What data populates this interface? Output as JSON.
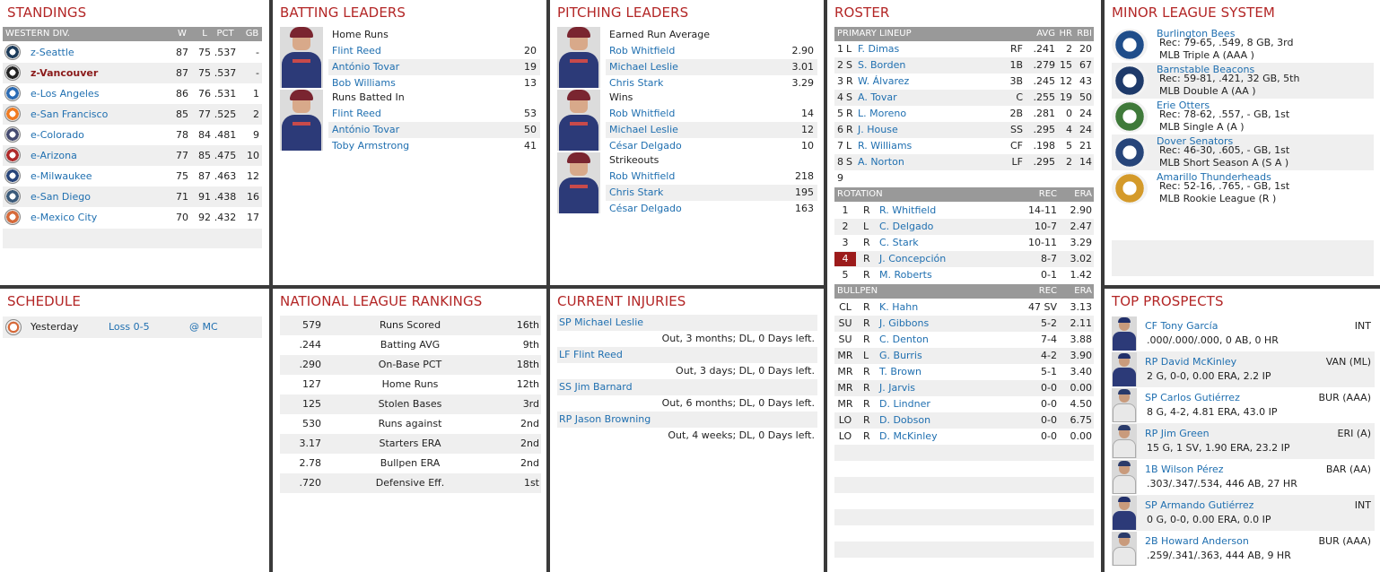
{
  "standings": {
    "title": "STANDINGS",
    "division": "WESTERN DIV.",
    "cols": [
      "W",
      "L",
      "PCT",
      "GB"
    ],
    "teams": [
      {
        "name": "z-Seattle",
        "w": "87",
        "l": "75",
        "pct": ".537",
        "gb": "-",
        "bold": false,
        "logo": "seattle-logo",
        "color": "#1c3b5a"
      },
      {
        "name": "z-Vancouver",
        "w": "87",
        "l": "75",
        "pct": ".537",
        "gb": "-",
        "bold": true,
        "logo": "vancouver-logo",
        "color": "#222"
      },
      {
        "name": "e-Los Angeles",
        "w": "86",
        "l": "76",
        "pct": ".531",
        "gb": "1",
        "bold": false,
        "logo": "los-angeles-logo",
        "color": "#2a6bb4"
      },
      {
        "name": "e-San Francisco",
        "w": "85",
        "l": "77",
        "pct": ".525",
        "gb": "2",
        "bold": false,
        "logo": "san-francisco-logo",
        "color": "#f07a20"
      },
      {
        "name": "e-Colorado",
        "w": "78",
        "l": "84",
        "pct": ".481",
        "gb": "9",
        "bold": false,
        "logo": "colorado-logo",
        "color": "#444a70"
      },
      {
        "name": "e-Arizona",
        "w": "77",
        "l": "85",
        "pct": ".475",
        "gb": "10",
        "bold": false,
        "logo": "arizona-logo",
        "color": "#b02a2a"
      },
      {
        "name": "e-Milwaukee",
        "w": "75",
        "l": "87",
        "pct": ".463",
        "gb": "12",
        "bold": false,
        "logo": "milwaukee-logo",
        "color": "#27457a"
      },
      {
        "name": "e-San Diego",
        "w": "71",
        "l": "91",
        "pct": ".438",
        "gb": "16",
        "bold": false,
        "logo": "san-diego-logo",
        "color": "#3a5a7a"
      },
      {
        "name": "e-Mexico City",
        "w": "70",
        "l": "92",
        "pct": ".432",
        "gb": "17",
        "bold": false,
        "logo": "mexico-city-logo",
        "color": "#d66a3a"
      }
    ]
  },
  "batting": {
    "title": "BATTING LEADERS",
    "groups": [
      {
        "label": "Home Runs",
        "rows": [
          {
            "name": "Flint Reed",
            "val": "20"
          },
          {
            "name": "António Tovar",
            "val": "19"
          },
          {
            "name": "Bob Williams",
            "val": "13"
          }
        ]
      },
      {
        "label": "Runs Batted In",
        "rows": [
          {
            "name": "Flint Reed",
            "val": "53"
          },
          {
            "name": "António Tovar",
            "val": "50"
          },
          {
            "name": "Toby Armstrong",
            "val": "41"
          }
        ]
      }
    ]
  },
  "pitching": {
    "title": "PITCHING LEADERS",
    "groups": [
      {
        "label": "Earned Run Average",
        "rows": [
          {
            "name": "Rob Whitfield",
            "val": "2.90"
          },
          {
            "name": "Michael Leslie",
            "val": "3.01"
          },
          {
            "name": "Chris Stark",
            "val": "3.29"
          }
        ]
      },
      {
        "label": "Wins",
        "rows": [
          {
            "name": "Rob Whitfield",
            "val": "14"
          },
          {
            "name": "Michael Leslie",
            "val": "12"
          },
          {
            "name": "César Delgado",
            "val": "10"
          }
        ]
      },
      {
        "label": "Strikeouts",
        "rows": [
          {
            "name": "Rob Whitfield",
            "val": "218"
          },
          {
            "name": "Chris Stark",
            "val": "195"
          },
          {
            "name": "César Delgado",
            "val": "163"
          }
        ]
      }
    ]
  },
  "roster": {
    "title": "ROSTER",
    "lineup_header": {
      "label": "PRIMARY LINEUP",
      "avg": "AVG",
      "hr": "HR",
      "rbi": "RBI"
    },
    "lineup": [
      {
        "n": "1",
        "h": "L",
        "name": "F. Dimas",
        "pos": "RF",
        "avg": ".241",
        "hr": "2",
        "rbi": "20"
      },
      {
        "n": "2",
        "h": "S",
        "name": "S. Borden",
        "pos": "1B",
        "avg": ".279",
        "hr": "15",
        "rbi": "67"
      },
      {
        "n": "3",
        "h": "R",
        "name": "W. Álvarez",
        "pos": "3B",
        "avg": ".245",
        "hr": "12",
        "rbi": "43"
      },
      {
        "n": "4",
        "h": "S",
        "name": "A. Tovar",
        "pos": "C",
        "avg": ".255",
        "hr": "19",
        "rbi": "50"
      },
      {
        "n": "5",
        "h": "R",
        "name": "L. Moreno",
        "pos": "2B",
        "avg": ".281",
        "hr": "0",
        "rbi": "24"
      },
      {
        "n": "6",
        "h": "R",
        "name": "J. House",
        "pos": "SS",
        "avg": ".295",
        "hr": "4",
        "rbi": "24"
      },
      {
        "n": "7",
        "h": "L",
        "name": "R. Williams",
        "pos": "CF",
        "avg": ".198",
        "hr": "5",
        "rbi": "21"
      },
      {
        "n": "8",
        "h": "S",
        "name": "A. Norton",
        "pos": "LF",
        "avg": ".295",
        "hr": "2",
        "rbi": "14"
      },
      {
        "n": "9",
        "h": "",
        "name": "",
        "pos": "",
        "avg": "",
        "hr": "",
        "rbi": ""
      }
    ],
    "rotation_header": {
      "label": "ROTATION",
      "rec": "REC",
      "era": "ERA"
    },
    "rotation": [
      {
        "n": "1",
        "h": "R",
        "name": "R. Whitfield",
        "rec": "14-11",
        "era": "2.90",
        "hl": false
      },
      {
        "n": "2",
        "h": "L",
        "name": "C. Delgado",
        "rec": "10-7",
        "era": "2.47",
        "hl": false
      },
      {
        "n": "3",
        "h": "R",
        "name": "C. Stark",
        "rec": "10-11",
        "era": "3.29",
        "hl": false
      },
      {
        "n": "4",
        "h": "R",
        "name": "J. Concepción",
        "rec": "8-7",
        "era": "3.02",
        "hl": true
      },
      {
        "n": "5",
        "h": "R",
        "name": "M. Roberts",
        "rec": "0-1",
        "era": "1.42",
        "hl": false
      }
    ],
    "bullpen_header": {
      "label": "BULLPEN",
      "rec": "REC",
      "era": "ERA"
    },
    "bullpen": [
      {
        "role": "CL",
        "h": "R",
        "name": "K. Hahn",
        "rec": "47 SV",
        "era": "3.13"
      },
      {
        "role": "SU",
        "h": "R",
        "name": "J. Gibbons",
        "rec": "5-2",
        "era": "2.11"
      },
      {
        "role": "SU",
        "h": "R",
        "name": "C. Denton",
        "rec": "7-4",
        "era": "3.88"
      },
      {
        "role": "MR",
        "h": "L",
        "name": "G. Burris",
        "rec": "4-2",
        "era": "3.90"
      },
      {
        "role": "MR",
        "h": "R",
        "name": "T. Brown",
        "rec": "5-1",
        "era": "3.40"
      },
      {
        "role": "MR",
        "h": "R",
        "name": "J. Jarvis",
        "rec": "0-0",
        "era": "0.00"
      },
      {
        "role": "MR",
        "h": "R",
        "name": "D. Lindner",
        "rec": "0-0",
        "era": "4.50"
      },
      {
        "role": "LO",
        "h": "R",
        "name": "D. Dobson",
        "rec": "0-0",
        "era": "6.75"
      },
      {
        "role": "LO",
        "h": "R",
        "name": "D. McKinley",
        "rec": "0-0",
        "era": "0.00"
      }
    ]
  },
  "minors": {
    "title": "MINOR LEAGUE SYSTEM",
    "teams": [
      {
        "name": "Burlington Bees",
        "rec": "Rec: 79-65, .549, 8 GB, 3rd",
        "lvl": "MLB Triple A (AAA )",
        "logo": "burlington-bees-logo",
        "color": "#1f4d8a"
      },
      {
        "name": "Barnstable Beacons",
        "rec": "Rec: 59-81, .421, 32 GB, 5th",
        "lvl": "MLB Double A (AA )",
        "logo": "barnstable-beacons-logo",
        "color": "#1e3a6a"
      },
      {
        "name": "Erie Otters",
        "rec": "Rec: 78-62, .557, - GB, 1st",
        "lvl": "MLB Single A (A )",
        "logo": "erie-otters-logo",
        "color": "#3f7a3a"
      },
      {
        "name": "Dover Senators",
        "rec": "Rec: 46-30, .605, - GB, 1st",
        "lvl": "MLB Short Season A (S A )",
        "logo": "dover-senators-logo",
        "color": "#27457a"
      },
      {
        "name": "Amarillo Thunderheads",
        "rec": "Rec: 52-16, .765, - GB, 1st",
        "lvl": "MLB Rookie League (R )",
        "logo": "amarillo-thunderheads-logo",
        "color": "#d49a2a"
      }
    ]
  },
  "schedule": {
    "title": "SCHEDULE",
    "rows": [
      {
        "day": "Yesterday",
        "result": "Loss 0-5",
        "opp": "@ MC"
      }
    ]
  },
  "rankings": {
    "title": "NATIONAL LEAGUE RANKINGS",
    "rows": [
      {
        "val": "579",
        "stat": "Runs Scored",
        "rank": "16th"
      },
      {
        "val": ".244",
        "stat": "Batting AVG",
        "rank": "9th"
      },
      {
        "val": ".290",
        "stat": "On-Base PCT",
        "rank": "18th"
      },
      {
        "val": "127",
        "stat": "Home Runs",
        "rank": "12th"
      },
      {
        "val": "125",
        "stat": "Stolen Bases",
        "rank": "3rd"
      },
      {
        "val": "530",
        "stat": "Runs against",
        "rank": "2nd"
      },
      {
        "val": "3.17",
        "stat": "Starters ERA",
        "rank": "2nd"
      },
      {
        "val": "2.78",
        "stat": "Bullpen ERA",
        "rank": "2nd"
      },
      {
        "val": ".720",
        "stat": "Defensive Eff.",
        "rank": "1st"
      }
    ]
  },
  "injuries": {
    "title": "CURRENT INJURIES",
    "rows": [
      {
        "name": "SP Michael Leslie",
        "status": "Out, 3 months; DL, 0 Days left."
      },
      {
        "name": "LF Flint Reed",
        "status": "Out, 3 days; DL, 0 Days left."
      },
      {
        "name": "SS Jim Barnard",
        "status": "Out, 6 months; DL, 0 Days left."
      },
      {
        "name": "RP Jason Browning",
        "status": "Out, 4 weeks; DL, 0 Days left."
      }
    ]
  },
  "prospects": {
    "title": "TOP PROSPECTS",
    "rows": [
      {
        "name": "CF Tony García",
        "team": "INT",
        "line": ".000/.000/.000, 0 AB, 0 HR",
        "white": false
      },
      {
        "name": "RP David McKinley",
        "team": "VAN (ML)",
        "line": "2 G, 0-0, 0.00 ERA, 2.2 IP",
        "white": false
      },
      {
        "name": "SP Carlos Gutiérrez",
        "team": "BUR (AAA)",
        "line": "8 G, 4-2, 4.81 ERA, 43.0 IP",
        "white": true
      },
      {
        "name": "RP Jim Green",
        "team": "ERI (A)",
        "line": "15 G, 1 SV, 1.90 ERA, 23.2 IP",
        "white": true
      },
      {
        "name": "1B Wilson Pérez",
        "team": "BAR (AA)",
        "line": ".303/.347/.534, 446 AB, 27 HR",
        "white": true
      },
      {
        "name": "SP Armando Gutiérrez",
        "team": "INT",
        "line": "0 G, 0-0, 0.00 ERA, 0.0 IP",
        "white": false
      },
      {
        "name": "2B Howard Anderson",
        "team": "BUR (AAA)",
        "line": ".259/.341/.363, 444 AB, 9 HR",
        "white": true
      }
    ]
  }
}
